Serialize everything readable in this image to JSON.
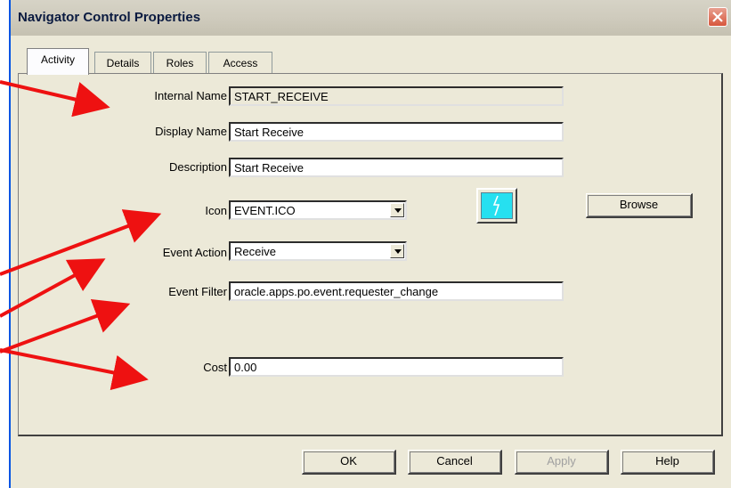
{
  "window": {
    "title": "Navigator Control Properties"
  },
  "tabs": [
    {
      "label": "Activity",
      "active": true
    },
    {
      "label": "Details",
      "active": false
    },
    {
      "label": "Roles",
      "active": false
    },
    {
      "label": "Access",
      "active": false
    }
  ],
  "form": {
    "internal_name": {
      "label": "Internal Name",
      "value": "START_RECEIVE"
    },
    "display_name": {
      "label": "Display Name",
      "value": "Start Receive"
    },
    "description": {
      "label": "Description",
      "value": "Start Receive"
    },
    "icon": {
      "label": "Icon",
      "value": "EVENT.ICO"
    },
    "event_action": {
      "label": "Event Action",
      "value": "Receive"
    },
    "event_filter": {
      "label": "Event Filter",
      "value": "oracle.apps.po.event.requester_change"
    },
    "cost": {
      "label": "Cost",
      "value": "0.00"
    }
  },
  "buttons": {
    "browse": "Browse",
    "ok": "OK",
    "cancel": "Cancel",
    "apply": "Apply",
    "help": "Help"
  },
  "colors": {
    "annotation_arrow": "#ee1111",
    "icon_preview_bg": "#26e0f0"
  },
  "icons": {
    "close": "close-x",
    "preview": "lightning-bolt"
  }
}
